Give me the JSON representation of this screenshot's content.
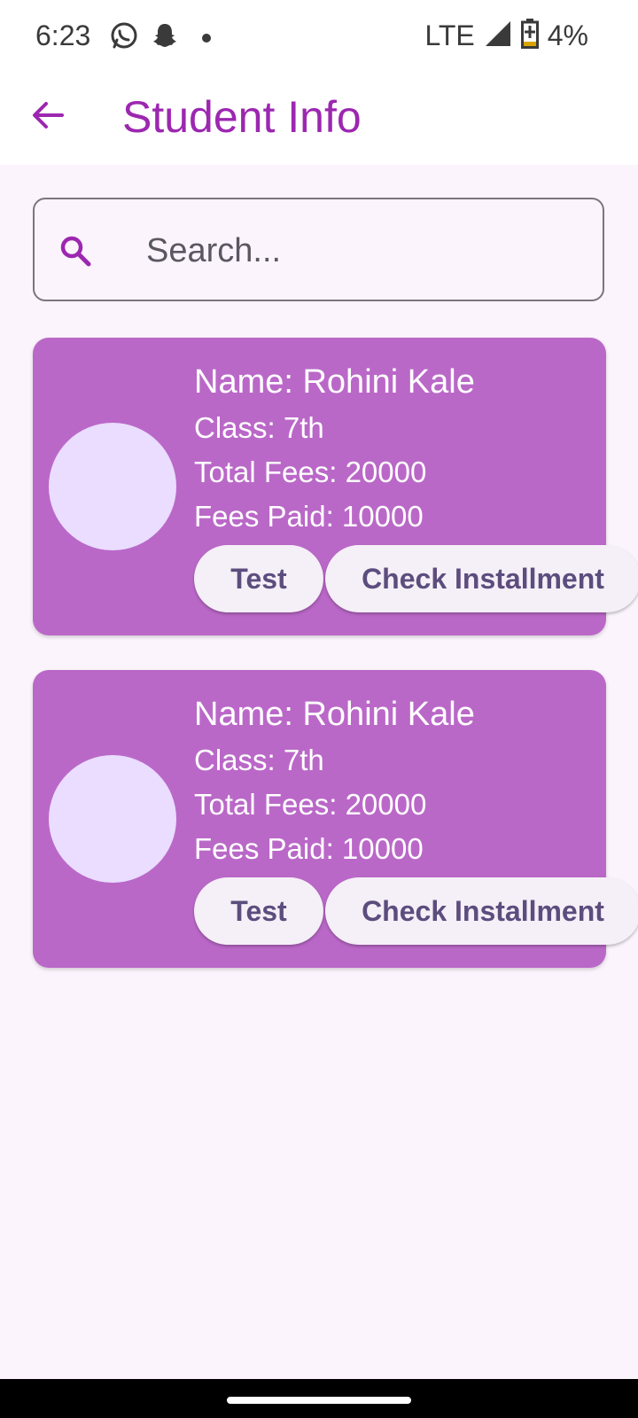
{
  "status_bar": {
    "time": "6:23",
    "network": "LTE",
    "battery": "4%",
    "icons": [
      "whatsapp-icon",
      "snapchat-icon",
      "dot-icon",
      "signal-icon",
      "battery-charging-icon"
    ]
  },
  "app_bar": {
    "title": "Student Info",
    "back_icon": "arrow-back-icon"
  },
  "search": {
    "placeholder": "Search...",
    "value": ""
  },
  "students": [
    {
      "name": "Name: Rohini Kale",
      "class": "Class: 7th",
      "total_fees": "Total Fees: 20000",
      "fees_paid": "Fees Paid: 10000",
      "buttons": {
        "test": "Test",
        "installment": "Check Installment"
      }
    },
    {
      "name": "Name: Rohini Kale",
      "class": "Class: 7th",
      "total_fees": "Total Fees: 20000",
      "fees_paid": "Fees Paid: 10000",
      "buttons": {
        "test": "Test",
        "installment": "Check Installment"
      }
    }
  ],
  "colors": {
    "accent": "#9C27B0",
    "card": "#BA68C8",
    "avatar": "#EADDFF",
    "background": "#FCF4FC",
    "button_bg": "#F5EFF7",
    "button_text": "#5C4D7E"
  }
}
